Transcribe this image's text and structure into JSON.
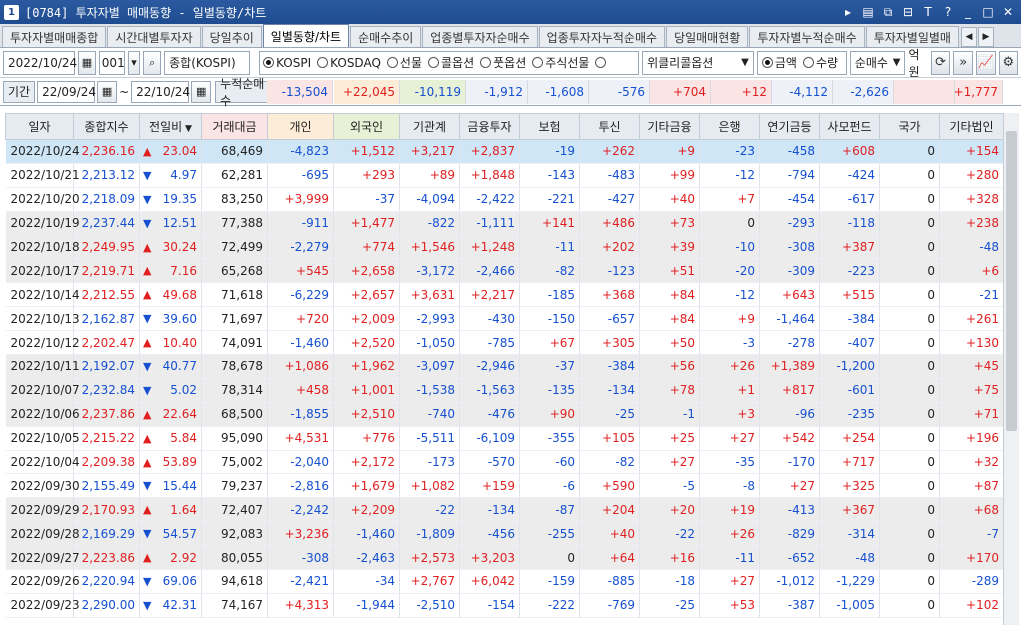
{
  "window": {
    "number": "1",
    "title": "[0784] 투자자별 매매동향 - 일별동향/차트"
  },
  "tabs": [
    {
      "label": "투자자별매매종합",
      "active": false
    },
    {
      "label": "시간대별투자자",
      "active": false
    },
    {
      "label": "당일추이",
      "active": false
    },
    {
      "label": "일별동향/차트",
      "active": true
    },
    {
      "label": "순매수추이",
      "active": false
    },
    {
      "label": "업종별투자자순매수",
      "active": false
    },
    {
      "label": "업종투자자누적순매수",
      "active": false
    },
    {
      "label": "당일매매현황",
      "active": false
    },
    {
      "label": "투자자별누적순매수",
      "active": false
    },
    {
      "label": "투자자별일별매",
      "active": false
    }
  ],
  "toolbar": {
    "date": "2022/10/24",
    "code": "001",
    "market_name": "종합(KOSPI)",
    "radios": [
      "KOSPI",
      "KOSDAQ",
      "선물",
      "콜옵션",
      "풋옵션",
      "주식선물"
    ],
    "selected_radio": "KOSPI",
    "weekly_option": "위클리콜옵션",
    "amount_label": "금액",
    "qty_label": "수량",
    "net_select": "순매수",
    "unit": "억원"
  },
  "period": {
    "label": "기간",
    "from": "22/09/24",
    "tilde": "~",
    "to": "22/10/24",
    "cum_label": "누적순매수"
  },
  "cumulative": [
    "-13,504",
    "+22,045",
    "-10,119",
    "-1,912",
    "-1,608",
    "-576",
    "+704",
    "+12",
    "-4,112",
    "-2,626",
    "",
    "+1,777"
  ],
  "headers": [
    "일자",
    "종합지수",
    "전일비",
    "거래대금",
    "개인",
    "외국인",
    "기관계",
    "금융투자",
    "보험",
    "투신",
    "기타금융",
    "은행",
    "연기금등",
    "사모펀드",
    "국가",
    "기타법인"
  ],
  "rows": [
    [
      "2022/10/24",
      "2,236.16",
      "▲",
      "23.04",
      "68,469",
      "-4,823",
      "+1,512",
      "+3,217",
      "+2,837",
      "-19",
      "+262",
      "+9",
      "-23",
      "-458",
      "+608",
      "0",
      "+154"
    ],
    [
      "2022/10/21",
      "2,213.12",
      "▼",
      "4.97",
      "62,281",
      "-695",
      "+293",
      "+89",
      "+1,848",
      "-143",
      "-483",
      "+99",
      "-12",
      "-794",
      "-424",
      "0",
      "+280"
    ],
    [
      "2022/10/20",
      "2,218.09",
      "▼",
      "19.35",
      "83,250",
      "+3,999",
      "-37",
      "-4,094",
      "-2,422",
      "-221",
      "-427",
      "+40",
      "+7",
      "-454",
      "-617",
      "0",
      "+328"
    ],
    [
      "2022/10/19",
      "2,237.44",
      "▼",
      "12.51",
      "77,388",
      "-911",
      "+1,477",
      "-822",
      "-1,111",
      "+141",
      "+486",
      "+73",
      "0",
      "-293",
      "-118",
      "0",
      "+238"
    ],
    [
      "2022/10/18",
      "2,249.95",
      "▲",
      "30.24",
      "72,499",
      "-2,279",
      "+774",
      "+1,546",
      "+1,248",
      "-11",
      "+202",
      "+39",
      "-10",
      "-308",
      "+387",
      "0",
      "-48"
    ],
    [
      "2022/10/17",
      "2,219.71",
      "▲",
      "7.16",
      "65,268",
      "+545",
      "+2,658",
      "-3,172",
      "-2,466",
      "-82",
      "-123",
      "+51",
      "-20",
      "-309",
      "-223",
      "0",
      "+6"
    ],
    [
      "2022/10/14",
      "2,212.55",
      "▲",
      "49.68",
      "71,618",
      "-6,229",
      "+2,657",
      "+3,631",
      "+2,217",
      "-185",
      "+368",
      "+84",
      "-12",
      "+643",
      "+515",
      "0",
      "-21"
    ],
    [
      "2022/10/13",
      "2,162.87",
      "▼",
      "39.60",
      "71,697",
      "+720",
      "+2,009",
      "-2,993",
      "-430",
      "-150",
      "-657",
      "+84",
      "+9",
      "-1,464",
      "-384",
      "0",
      "+261"
    ],
    [
      "2022/10/12",
      "2,202.47",
      "▲",
      "10.40",
      "74,091",
      "-1,460",
      "+2,520",
      "-1,050",
      "-785",
      "+67",
      "+305",
      "+50",
      "-3",
      "-278",
      "-407",
      "0",
      "+130"
    ],
    [
      "2022/10/11",
      "2,192.07",
      "▼",
      "40.77",
      "78,678",
      "+1,086",
      "+1,962",
      "-3,097",
      "-2,946",
      "-37",
      "-384",
      "+56",
      "+26",
      "+1,389",
      "-1,200",
      "0",
      "+45"
    ],
    [
      "2022/10/07",
      "2,232.84",
      "▼",
      "5.02",
      "78,314",
      "+458",
      "+1,001",
      "-1,538",
      "-1,563",
      "-135",
      "-134",
      "+78",
      "+1",
      "+817",
      "-601",
      "0",
      "+75"
    ],
    [
      "2022/10/06",
      "2,237.86",
      "▲",
      "22.64",
      "68,500",
      "-1,855",
      "+2,510",
      "-740",
      "-476",
      "+90",
      "-25",
      "-1",
      "+3",
      "-96",
      "-235",
      "0",
      "+71"
    ],
    [
      "2022/10/05",
      "2,215.22",
      "▲",
      "5.84",
      "95,090",
      "+4,531",
      "+776",
      "-5,511",
      "-6,109",
      "-355",
      "+105",
      "+25",
      "+27",
      "+542",
      "+254",
      "0",
      "+196"
    ],
    [
      "2022/10/04",
      "2,209.38",
      "▲",
      "53.89",
      "75,002",
      "-2,040",
      "+2,172",
      "-173",
      "-570",
      "-60",
      "-82",
      "+27",
      "-35",
      "-170",
      "+717",
      "0",
      "+32"
    ],
    [
      "2022/09/30",
      "2,155.49",
      "▼",
      "15.44",
      "79,237",
      "-2,816",
      "+1,679",
      "+1,082",
      "+159",
      "-6",
      "+590",
      "-5",
      "-8",
      "+27",
      "+325",
      "0",
      "+87"
    ],
    [
      "2022/09/29",
      "2,170.93",
      "▲",
      "1.64",
      "72,407",
      "-2,242",
      "+2,209",
      "-22",
      "-134",
      "-87",
      "+204",
      "+20",
      "+19",
      "-413",
      "+367",
      "0",
      "+68"
    ],
    [
      "2022/09/28",
      "2,169.29",
      "▼",
      "54.57",
      "92,083",
      "+3,236",
      "-1,460",
      "-1,809",
      "-456",
      "-255",
      "+40",
      "-22",
      "+26",
      "-829",
      "-314",
      "0",
      "-7"
    ],
    [
      "2022/09/27",
      "2,223.86",
      "▲",
      "2.92",
      "80,055",
      "-308",
      "-2,463",
      "+2,573",
      "+3,203",
      "0",
      "+64",
      "+16",
      "-11",
      "-652",
      "-48",
      "0",
      "+170"
    ],
    [
      "2022/09/26",
      "2,220.94",
      "▼",
      "69.06",
      "94,618",
      "-2,421",
      "-34",
      "+2,767",
      "+6,042",
      "-159",
      "-885",
      "-18",
      "+27",
      "-1,012",
      "-1,229",
      "0",
      "-289"
    ],
    [
      "2022/09/23",
      "2,290.00",
      "▼",
      "42.31",
      "74,167",
      "+4,313",
      "-1,944",
      "-2,510",
      "-154",
      "-222",
      "-769",
      "-25",
      "+53",
      "-387",
      "-1,005",
      "0",
      "+102"
    ]
  ],
  "colors": {
    "up": "#e02020",
    "down": "#1550d0",
    "header_personal": "#fbe4e4",
    "header_foreign": "#fdecd7",
    "header_inst": "#e6f1d6"
  }
}
